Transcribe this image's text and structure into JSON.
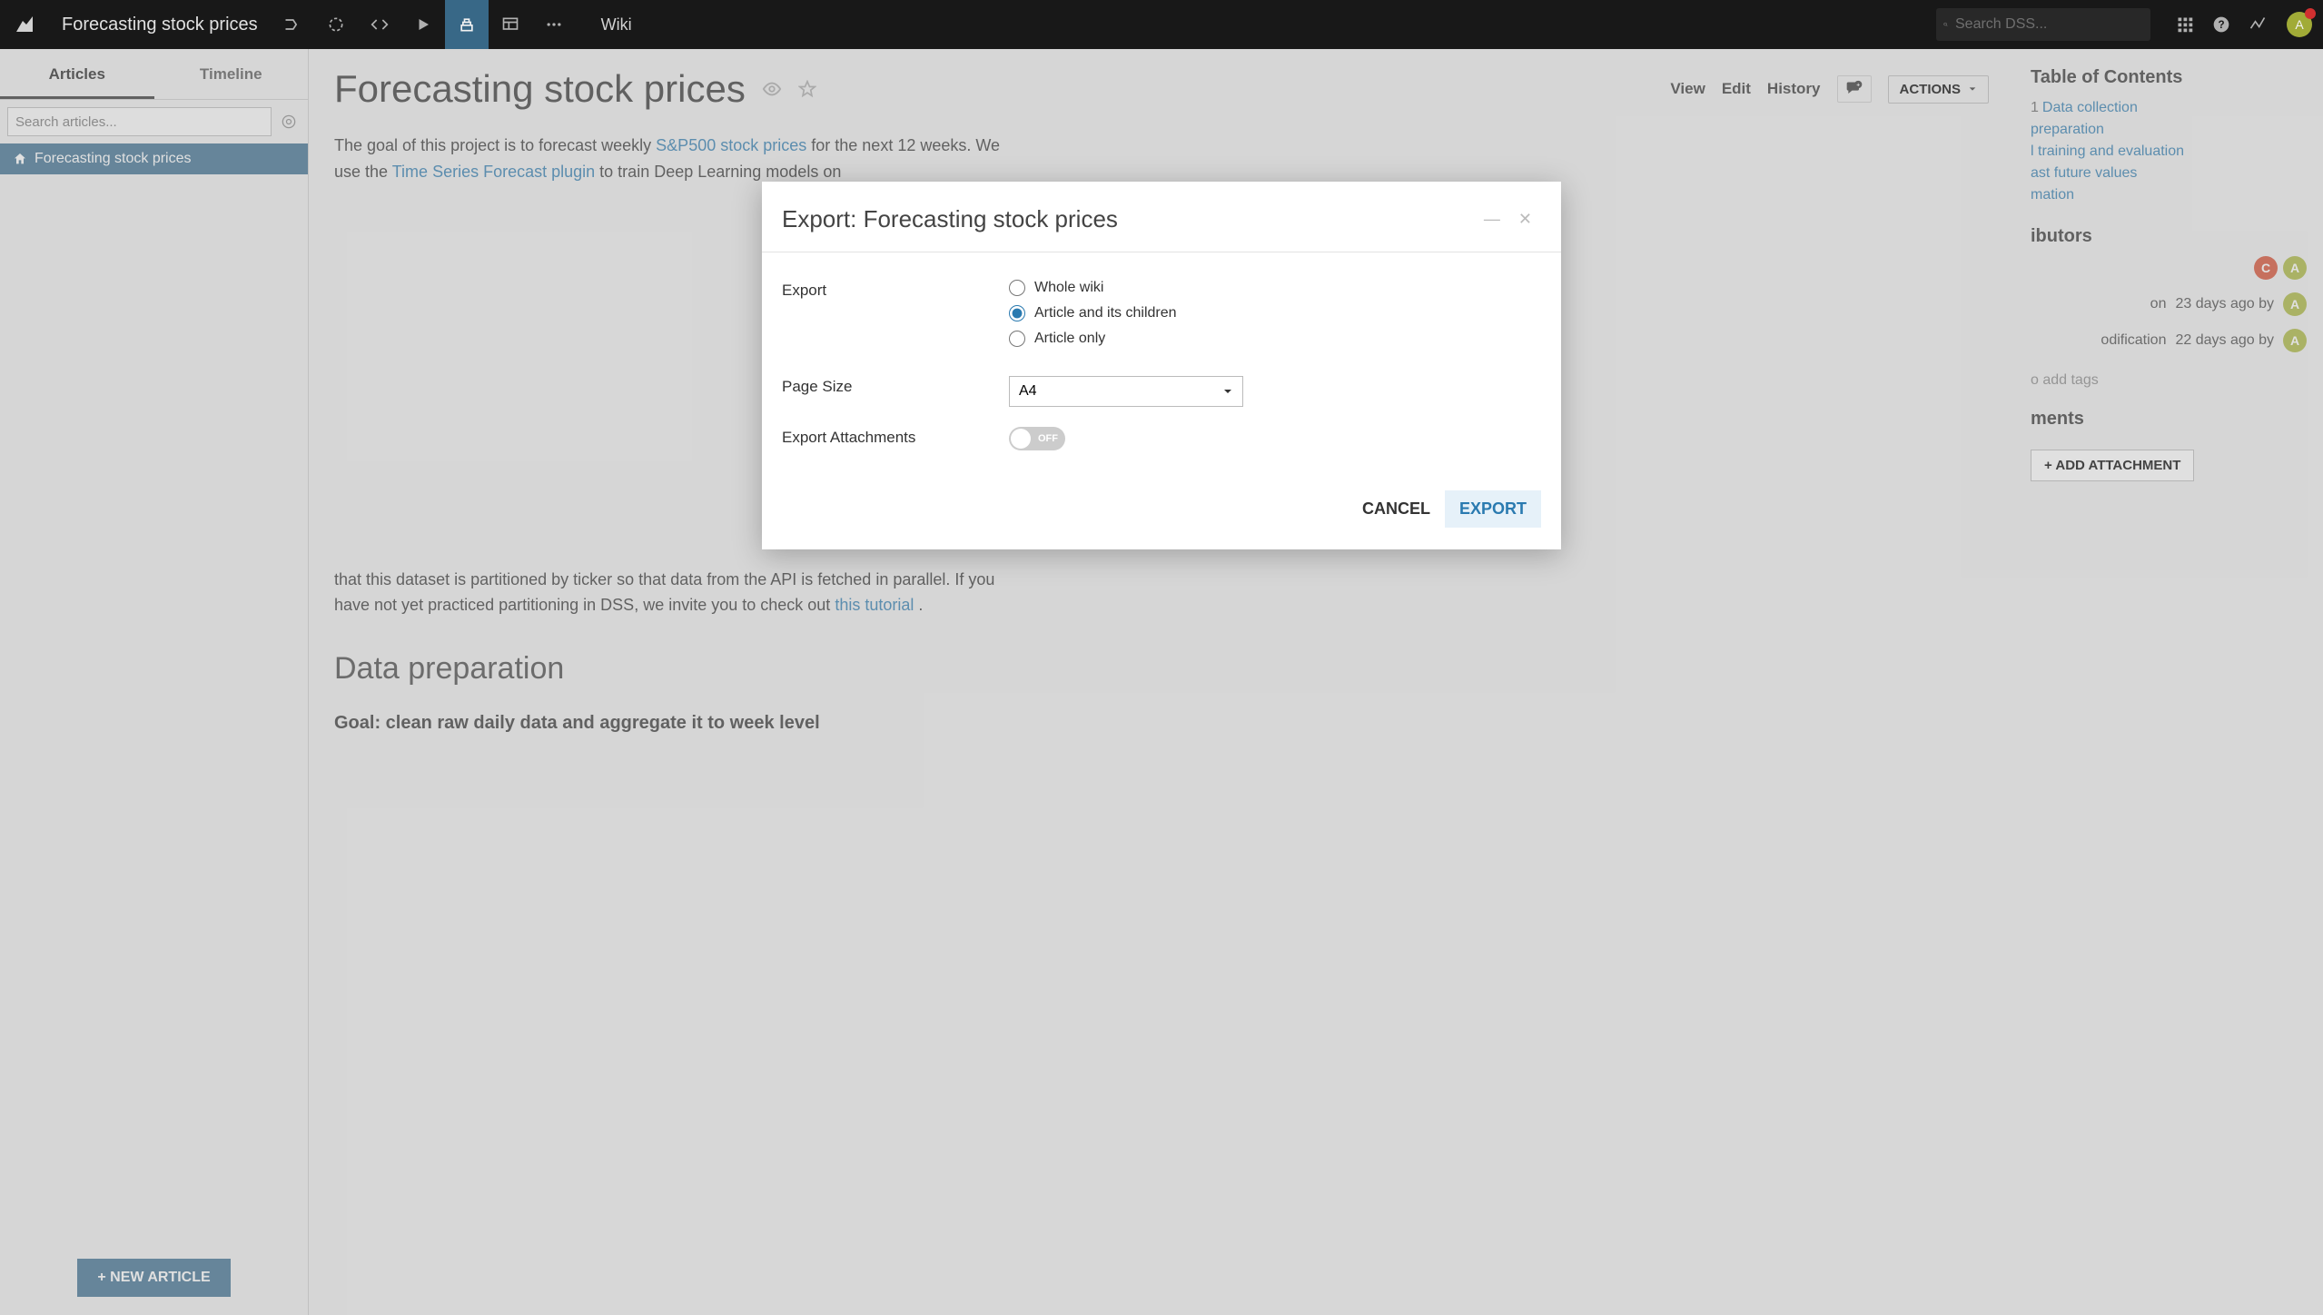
{
  "topbar": {
    "project_title": "Forecasting stock prices",
    "wiki_label": "Wiki",
    "search_placeholder": "Search DSS...",
    "avatar_initial": "A"
  },
  "sidebar": {
    "tabs": {
      "articles": "Articles",
      "timeline": "Timeline"
    },
    "search_placeholder": "Search articles...",
    "tree_item": "Forecasting stock prices",
    "new_article": "+ NEW ARTICLE"
  },
  "article": {
    "title": "Forecasting stock prices",
    "links": {
      "view": "View",
      "edit": "Edit",
      "history": "History",
      "actions": "ACTIONS"
    },
    "body": {
      "p1a": "The goal of this project is to forecast weekly ",
      "p1_link1": "S&P500 stock prices",
      "p1b": " for the next 12 weeks. We use the ",
      "p1_link2": "Time Series Forecast plugin",
      "p1c": " to train Deep Learning models on",
      "p2a": "that this dataset is partitioned by ticker so that data from the API is fetched in parallel. If you have not yet practiced partitioning in DSS, we invite you to check out ",
      "p2_link": "this tutorial",
      "p2b": ".",
      "h2": "Data preparation",
      "goal": "Goal: clean raw daily data and aggregate it to week level"
    }
  },
  "rightpanel": {
    "toc_title": "Table of Contents",
    "toc": [
      {
        "n": "1",
        "t": "Data collection"
      },
      {
        "n": "",
        "t": "preparation"
      },
      {
        "n": "",
        "t": "l training and evaluation"
      },
      {
        "n": "",
        "t": "ast future values"
      },
      {
        "n": "",
        "t": "mation"
      }
    ],
    "contributors_title": "ibutors",
    "meta1": {
      "label": "on",
      "time": "23 days ago by"
    },
    "meta2": {
      "label": "odification",
      "time": "22 days ago by"
    },
    "addtags": "o add tags",
    "attachments_title": "ments",
    "add_attachment": "+ ADD ATTACHMENT"
  },
  "modal": {
    "title": "Export: Forecasting stock prices",
    "export_label": "Export",
    "opts": {
      "whole": "Whole wiki",
      "children": "Article and its children",
      "only": "Article only"
    },
    "pagesize_label": "Page Size",
    "pagesize_value": "A4",
    "attachments_label": "Export Attachments",
    "toggle_off": "OFF",
    "cancel": "CANCEL",
    "export": "EXPORT"
  }
}
